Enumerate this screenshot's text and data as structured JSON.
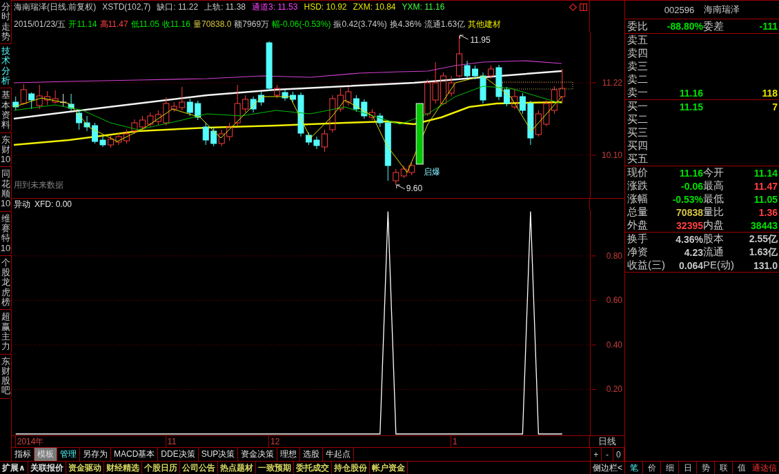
{
  "sidebar": {
    "tabs": [
      {
        "label": "分时走势",
        "selected": false
      },
      {
        "label": "技术分析",
        "selected": true
      },
      {
        "label": "基本资料",
        "selected": false
      },
      {
        "label": "东财10",
        "selected": false
      },
      {
        "label": "同花顺10",
        "selected": false
      },
      {
        "label": "维赛特10",
        "selected": false
      },
      {
        "label": "个股龙虎榜",
        "selected": false
      },
      {
        "label": "超赢主力",
        "selected": false
      },
      {
        "label": "东财股吧",
        "selected": false
      }
    ]
  },
  "price_chart": {
    "title": "海南瑞泽(日线.前复权)",
    "indicators": [
      {
        "text": "XSTD(102,7)",
        "color": "#c8c8c8"
      },
      {
        "text": "缺口: 11.22",
        "color": "#c8c8c8"
      },
      {
        "text": "上轨: 11.38",
        "color": "#c8c8c8"
      },
      {
        "text": "通道3: 11.53",
        "color": "#ff40ff"
      },
      {
        "text": "HSD: 10.92",
        "color": "#e6e600"
      },
      {
        "text": "ZXM: 10.84",
        "color": "#e6e600"
      },
      {
        "text": "YXM: 11.16",
        "color": "#40ff40"
      }
    ],
    "quote_fields": [
      {
        "text": "2015/01/23/五",
        "color": "#c8c8c8"
      },
      {
        "text": "开11.14",
        "color": "#00e000"
      },
      {
        "text": "高11.47",
        "color": "#ff4040"
      },
      {
        "text": "低11.05",
        "color": "#00e000"
      },
      {
        "text": "收11.16",
        "color": "#00e000"
      },
      {
        "text": "量70838.0",
        "color": "#d8c840"
      },
      {
        "text": "额7969万",
        "color": "#c8c8c8"
      },
      {
        "text": "幅-0.06(-0.53%)",
        "color": "#00e000"
      },
      {
        "text": "振0.42(3.74%)",
        "color": "#c8c8c8"
      },
      {
        "text": "换4.36%",
        "color": "#c8c8c8"
      },
      {
        "text": "流通1.63亿",
        "color": "#c8c8c8"
      },
      {
        "text": "其他建材",
        "color": "#e6e600"
      }
    ],
    "price_labels": [
      "11.22",
      "10.10"
    ],
    "high_label": "11.95",
    "low_label": "9.60",
    "signal_label": "启爆",
    "note": "用到未来数据"
  },
  "indicator_chart": {
    "name": "异动",
    "value": "XFD: 0.00",
    "chart_data": {
      "type": "line",
      "grid": true,
      "ylim": [
        0,
        1.06
      ],
      "yticks": [
        {
          "value": 0.8,
          "label": "0.80"
        },
        {
          "value": 0.6,
          "label": "0.60"
        },
        {
          "value": 0.4,
          "label": "0.40"
        },
        {
          "value": 0.2,
          "label": "0.20"
        }
      ],
      "series": [
        {
          "color": "#ffffff",
          "values": [
            0,
            0,
            0,
            0,
            0,
            0,
            0,
            0,
            0,
            0,
            0,
            0,
            0,
            0,
            0,
            0,
            0,
            0,
            0,
            0,
            0,
            0,
            0,
            0,
            0,
            0,
            0,
            0,
            0,
            0,
            0,
            0,
            0,
            0,
            0,
            0,
            0,
            0,
            0,
            0,
            0,
            0,
            0,
            0,
            0,
            0,
            0,
            1,
            0,
            0,
            0,
            0,
            0,
            0,
            0,
            0,
            0,
            0,
            0,
            0,
            0,
            0,
            0,
            0,
            0,
            1,
            0,
            0,
            0,
            0,
            null,
            null,
            null
          ]
        }
      ]
    },
    "date_axis": [
      "2014年",
      "11",
      "12",
      "1"
    ]
  },
  "period": "日线",
  "zoom_buttons": [
    "+",
    "-",
    "0"
  ],
  "toolbar": [
    {
      "label": "指标",
      "selected": false,
      "pressed": false
    },
    {
      "label": "模板",
      "selected": false,
      "pressed": true
    },
    {
      "label": "管理",
      "selected": true,
      "pressed": false
    },
    {
      "label": "另存为",
      "selected": false,
      "pressed": false
    },
    {
      "label": "MACD基本",
      "selected": false,
      "pressed": false
    },
    {
      "label": "DDE决策",
      "selected": false,
      "pressed": false
    },
    {
      "label": "SUP决策",
      "selected": false,
      "pressed": false
    },
    {
      "label": "资金决策",
      "selected": false,
      "pressed": false
    },
    {
      "label": "理想",
      "selected": false,
      "pressed": false
    },
    {
      "label": "选股",
      "selected": false,
      "pressed": false
    },
    {
      "label": "牛起点",
      "selected": false,
      "pressed": false
    }
  ],
  "quote_panel": {
    "code": "002596",
    "name": "海南瑞泽",
    "order_book_summary": [
      {
        "label": "委比",
        "value": "-88.80%",
        "color": "#00e000"
      },
      {
        "label": "委差",
        "value": "-111",
        "color": "#00e000"
      }
    ],
    "asks": [
      {
        "label": "卖五"
      },
      {
        "label": "卖四"
      },
      {
        "label": "卖三"
      },
      {
        "label": "卖二"
      },
      {
        "label": "卖一",
        "price": "11.16",
        "volume": "118",
        "color": "#00e000"
      }
    ],
    "bids": [
      {
        "label": "买一",
        "price": "11.15",
        "volume": "7",
        "color": "#00e000"
      },
      {
        "label": "买二"
      },
      {
        "label": "买三"
      },
      {
        "label": "买四"
      },
      {
        "label": "买五"
      }
    ],
    "stats": [
      {
        "label": "现价",
        "value": "11.16",
        "color": "#00e000"
      },
      {
        "label": "今开",
        "value": "11.14",
        "color": "#00e000"
      },
      {
        "label": "涨跌",
        "value": "-0.06",
        "color": "#00e000"
      },
      {
        "label": "最高",
        "value": "11.47",
        "color": "#ff4040"
      },
      {
        "label": "涨幅",
        "value": "-0.53%",
        "color": "#00e000"
      },
      {
        "label": "最低",
        "value": "11.05",
        "color": "#00e000"
      },
      {
        "label": "总量",
        "value": "70838",
        "color": "#d8c840"
      },
      {
        "label": "量比",
        "value": "1.36",
        "color": "#ff4040"
      },
      {
        "label": "外盘",
        "value": "32395",
        "color": "#ff4040"
      },
      {
        "label": "内盘",
        "value": "38443",
        "color": "#00e000"
      }
    ],
    "fundamentals": [
      {
        "label": "换手",
        "value": "4.36%"
      },
      {
        "label": "股本",
        "value": "2.55亿"
      },
      {
        "label": "净资",
        "value": "4.23"
      },
      {
        "label": "流通",
        "value": "1.63亿"
      },
      {
        "label": "收益(三)",
        "value": "0.064"
      },
      {
        "label": "PE(动)",
        "value": "131.0"
      }
    ]
  },
  "bottom_bar": {
    "items": [
      {
        "label": "扩展∧",
        "color": "#e0e0e0"
      },
      {
        "label": "关联报价",
        "color": "#e0e0e0"
      },
      {
        "label": "资金驱动",
        "color": "#d8d860"
      },
      {
        "label": "财经精选",
        "color": "#d8d860"
      },
      {
        "label": "个股日历",
        "color": "#d8d860"
      },
      {
        "label": "公司公告",
        "color": "#d8d860"
      },
      {
        "label": "热点题材",
        "color": "#d8d860"
      },
      {
        "label": "一致预期",
        "color": "#d8d860"
      },
      {
        "label": "委托成交",
        "color": "#d8d860"
      },
      {
        "label": "持仓股份",
        "color": "#d8d860"
      },
      {
        "label": "帐户资金",
        "color": "#d8d860"
      }
    ],
    "sidebar_toggle": "侧边栏<",
    "tabs": [
      {
        "label": "笔",
        "selected": true
      },
      {
        "label": "价",
        "selected": false
      },
      {
        "label": "细",
        "selected": false
      },
      {
        "label": "日",
        "selected": false
      },
      {
        "label": "势",
        "selected": false
      },
      {
        "label": "联",
        "selected": false
      },
      {
        "label": "值",
        "selected": false
      }
    ],
    "brand": "通达信"
  }
}
